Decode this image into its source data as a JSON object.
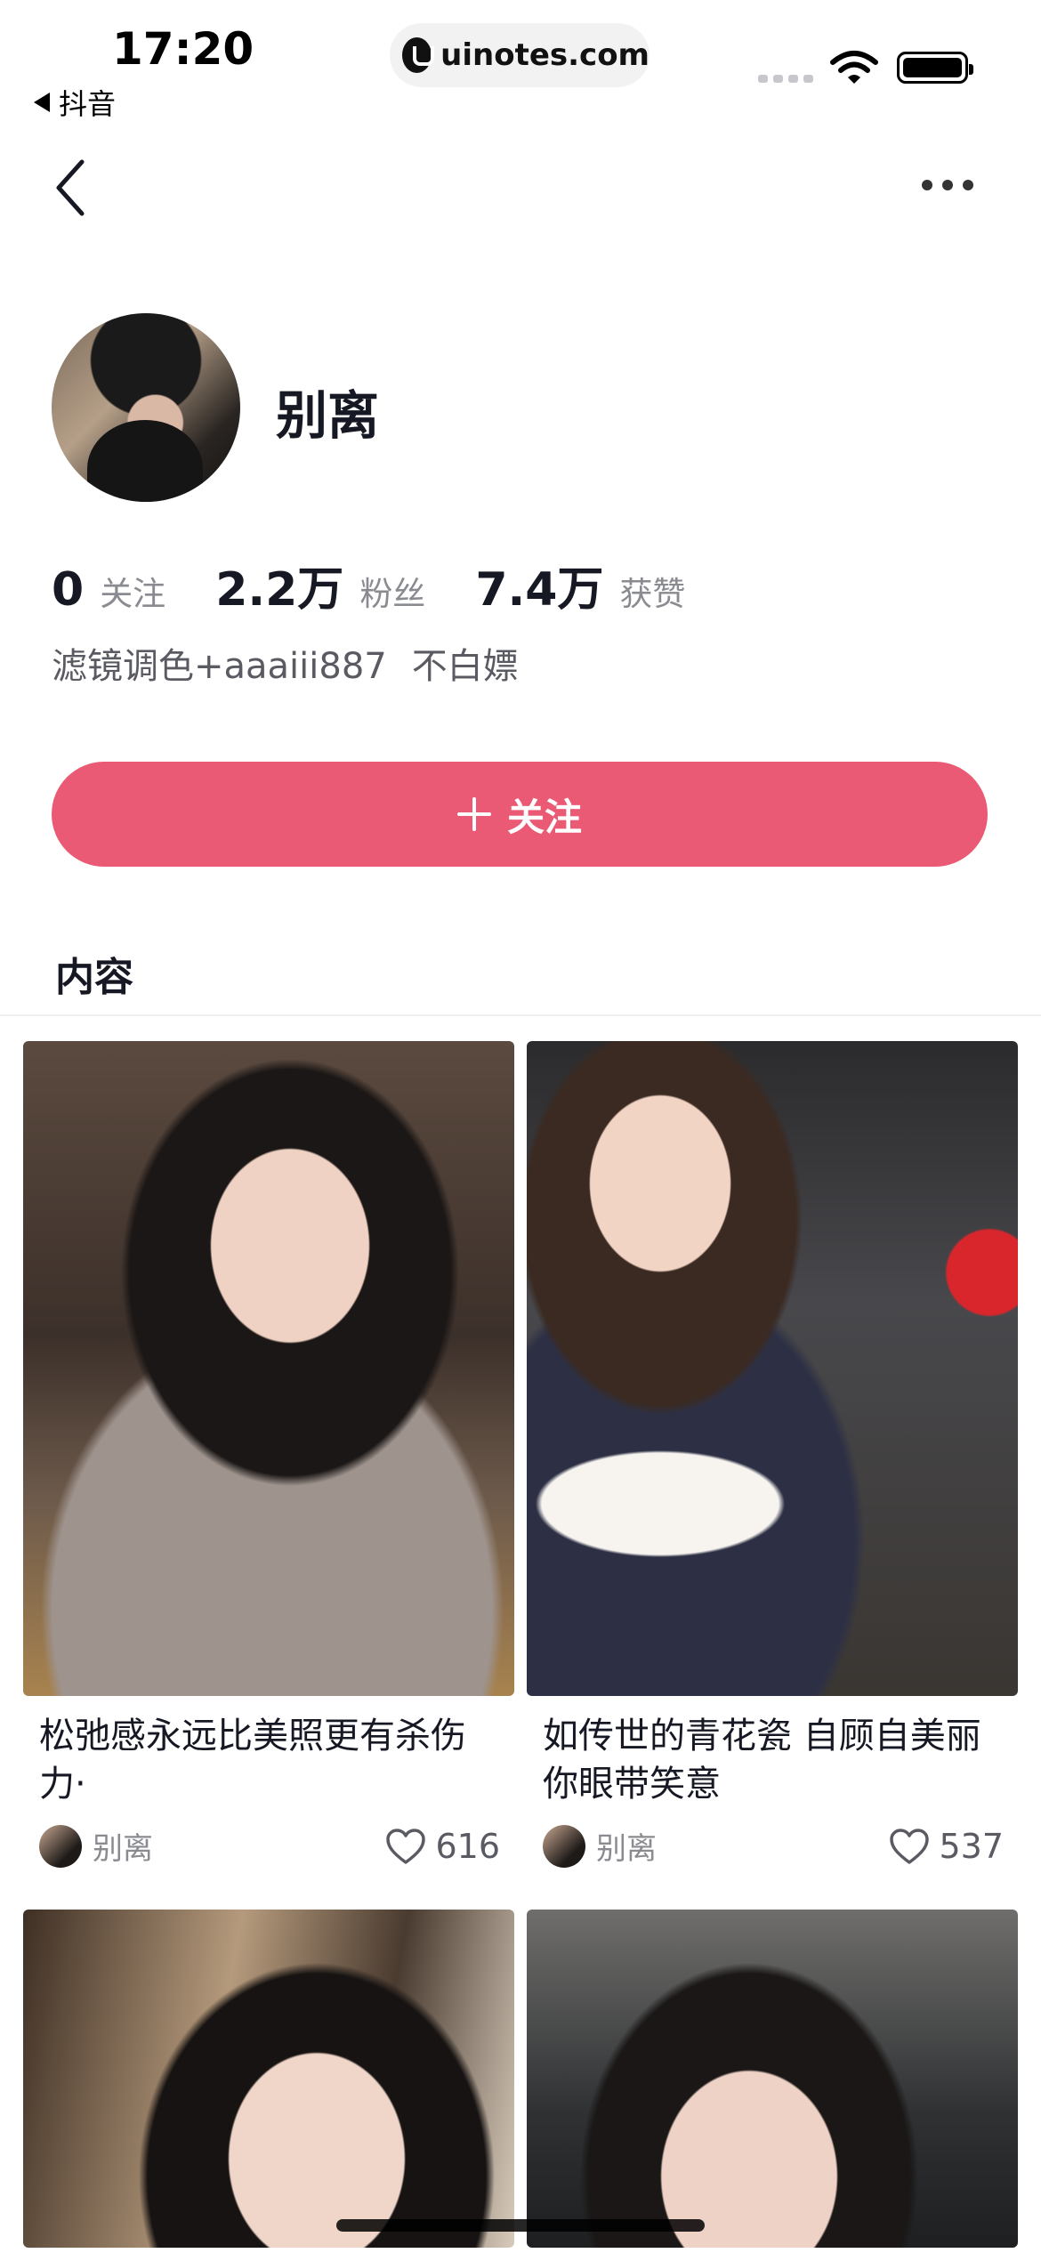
{
  "status_bar": {
    "time": "17:20",
    "back_app": "抖音",
    "url": "uinotes.com"
  },
  "profile": {
    "name": "别离",
    "stats": [
      {
        "value": "0",
        "label": "关注"
      },
      {
        "value": "2.2万",
        "label": "粉丝"
      },
      {
        "value": "7.4万",
        "label": "获赞"
      }
    ],
    "bio": [
      "滤镜调色+aaaiii887",
      "不白嫖"
    ]
  },
  "follow_button": {
    "label": "关注"
  },
  "section": {
    "title": "内容"
  },
  "posts": [
    {
      "title": "松弛感永远比美照更有杀伤力·",
      "author": "别离",
      "likes": "616"
    },
    {
      "title": "如传世的青花瓷 自顾自美丽 你眼带笑意",
      "author": "别离",
      "likes": "537"
    }
  ],
  "colors": {
    "accent": "#eb5a74",
    "text_primary": "#161823",
    "text_secondary": "#8a8b91"
  },
  "icons": [
    "back-arrow-icon",
    "more-icon",
    "plus-icon",
    "heart-icon",
    "wifi-icon",
    "battery-icon"
  ]
}
